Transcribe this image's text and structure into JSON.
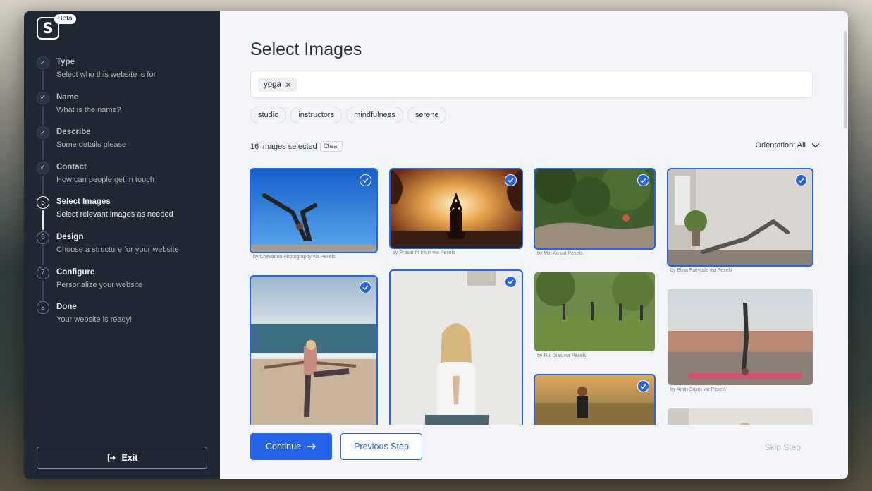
{
  "sidebar": {
    "logo_letter": "S",
    "beta_label": "Beta",
    "steps": [
      {
        "marker": "✓",
        "title": "Type",
        "subtitle": "Select who this website is for",
        "state": "done"
      },
      {
        "marker": "✓",
        "title": "Name",
        "subtitle": "What is the name?",
        "state": "done"
      },
      {
        "marker": "✓",
        "title": "Describe",
        "subtitle": "Some details please",
        "state": "done"
      },
      {
        "marker": "✓",
        "title": "Contact",
        "subtitle": "How can people get in touch",
        "state": "done"
      },
      {
        "marker": "5",
        "title": "Select Images",
        "subtitle": "Select relevant images as needed",
        "state": "active"
      },
      {
        "marker": "6",
        "title": "Design",
        "subtitle": "Choose a structure for your website",
        "state": "todo"
      },
      {
        "marker": "7",
        "title": "Configure",
        "subtitle": "Personalize your website",
        "state": "todo"
      },
      {
        "marker": "8",
        "title": "Done",
        "subtitle": "Your website is ready!",
        "state": "todo"
      }
    ],
    "exit_label": "Exit"
  },
  "main": {
    "title": "Select Images",
    "search_tag": "yoga",
    "suggestions": [
      "studio",
      "instructors",
      "mindfulness",
      "serene"
    ],
    "selected_count_text": "16 images selected",
    "clear_label": "Clear",
    "orientation_label": "Orientation: All",
    "images": [
      {
        "credit": "by Chevanon Photography via Pexels",
        "selected": true,
        "scene": "handstand-sky"
      },
      {
        "credit": "by Prasanth Inturi via Pexels",
        "selected": true,
        "scene": "sunset-meditation"
      },
      {
        "credit": "by Min An via Pexels",
        "selected": true,
        "scene": "forest-rocks"
      },
      {
        "credit": "by Elina Fairytale via Pexels",
        "selected": true,
        "scene": "studio-pose"
      },
      {
        "credit": "",
        "selected": true,
        "scene": "beach-balance"
      },
      {
        "credit": "",
        "selected": true,
        "scene": "woman-prayer"
      },
      {
        "credit": "by Rui Dias via Pexels",
        "selected": false,
        "scene": "park-group"
      },
      {
        "credit": "",
        "selected": true,
        "scene": "lake-sunset"
      },
      {
        "credit": "by Amin Sujan via Pexels",
        "selected": false,
        "scene": "rooftop-class"
      },
      {
        "credit": "",
        "selected": false,
        "scene": "partial-bottom"
      }
    ]
  },
  "footer": {
    "continue_label": "Continue",
    "previous_label": "Previous Step",
    "skip_label": "Skip Step"
  },
  "colors": {
    "accent": "#2563eb",
    "sidebar_bg": "#1e2733",
    "main_bg": "#f4f5f8"
  }
}
